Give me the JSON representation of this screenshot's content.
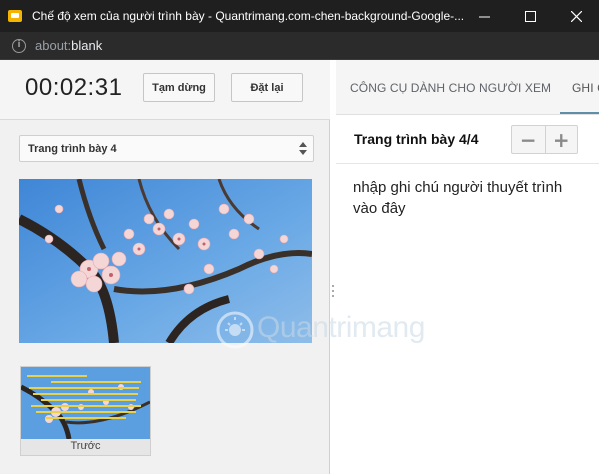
{
  "window": {
    "title": "Chế độ xem của người trình bày - Quantrimang.com-chen-background-Google-...",
    "url_prefix": "about:",
    "url_host": "blank"
  },
  "presenter": {
    "timer": "00:02:31",
    "pause_label": "Tạm dừng",
    "reset_label": "Đặt lại",
    "slide_select": "Trang trình bày 4",
    "thumb_label": "Trước"
  },
  "panel": {
    "tabs": [
      "CÔNG CỤ DÀNH CHO NGƯỜI XEM",
      "GHI CHÚ"
    ],
    "slide_counter": "Trang trình bày 4/4",
    "zoom_out": "−",
    "zoom_in": "+",
    "notes_placeholder": "nhập ghi chú người thuyết trình vào đây"
  },
  "watermark": "Quantrimang",
  "colors": {
    "titlebar": "#1f1f1f",
    "accent_tab": "#5f8fa8",
    "sky": "#5b9fe0",
    "blossom": "#f4d6d6"
  }
}
